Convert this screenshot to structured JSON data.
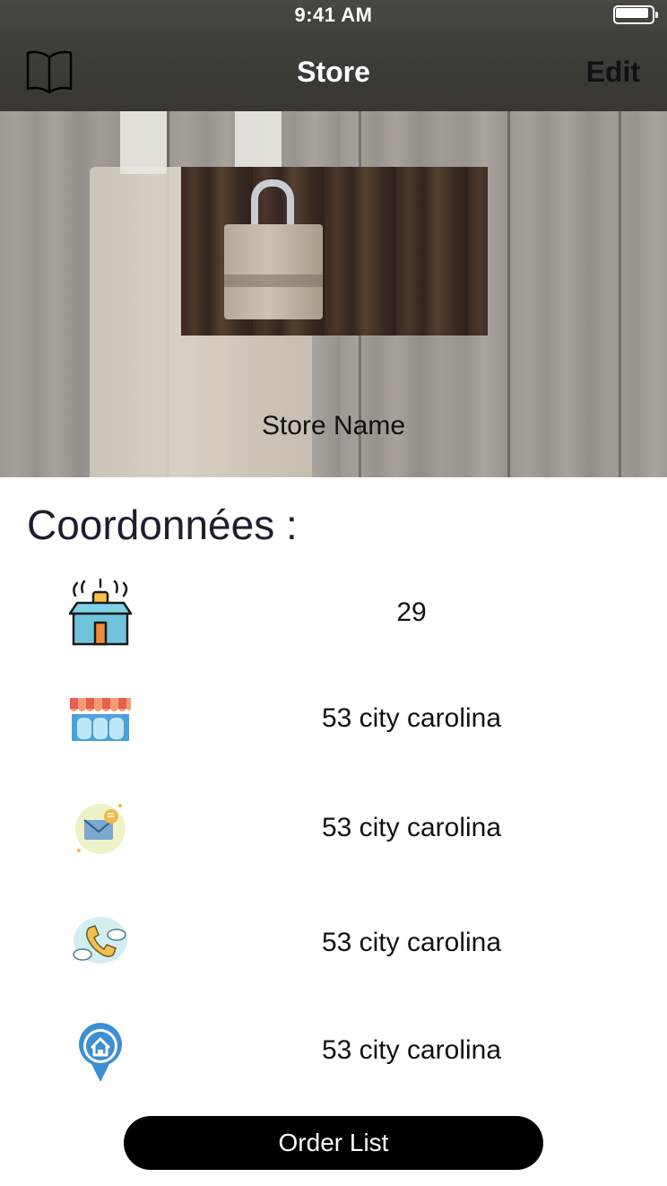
{
  "status_bar": {
    "time": "9:41 AM"
  },
  "nav": {
    "title": "Store",
    "edit_label": "Edit",
    "left_icon": "book-icon"
  },
  "hero": {
    "store_name": "Store Name"
  },
  "coordinates": {
    "title": "Coordonnées :",
    "rows": [
      {
        "icon": "gift-box-icon",
        "value": "29"
      },
      {
        "icon": "storefront-icon",
        "value": "53 city carolina"
      },
      {
        "icon": "mail-icon",
        "value": "53 city carolina"
      },
      {
        "icon": "phone-icon",
        "value": "53 city carolina"
      },
      {
        "icon": "location-pin-icon",
        "value": "53 city carolina"
      }
    ]
  },
  "order_button": {
    "label": "Order List"
  },
  "colors": {
    "nav_bg": "#3e3a36",
    "button_bg": "#000000",
    "title_text": "#1f1d2e"
  }
}
